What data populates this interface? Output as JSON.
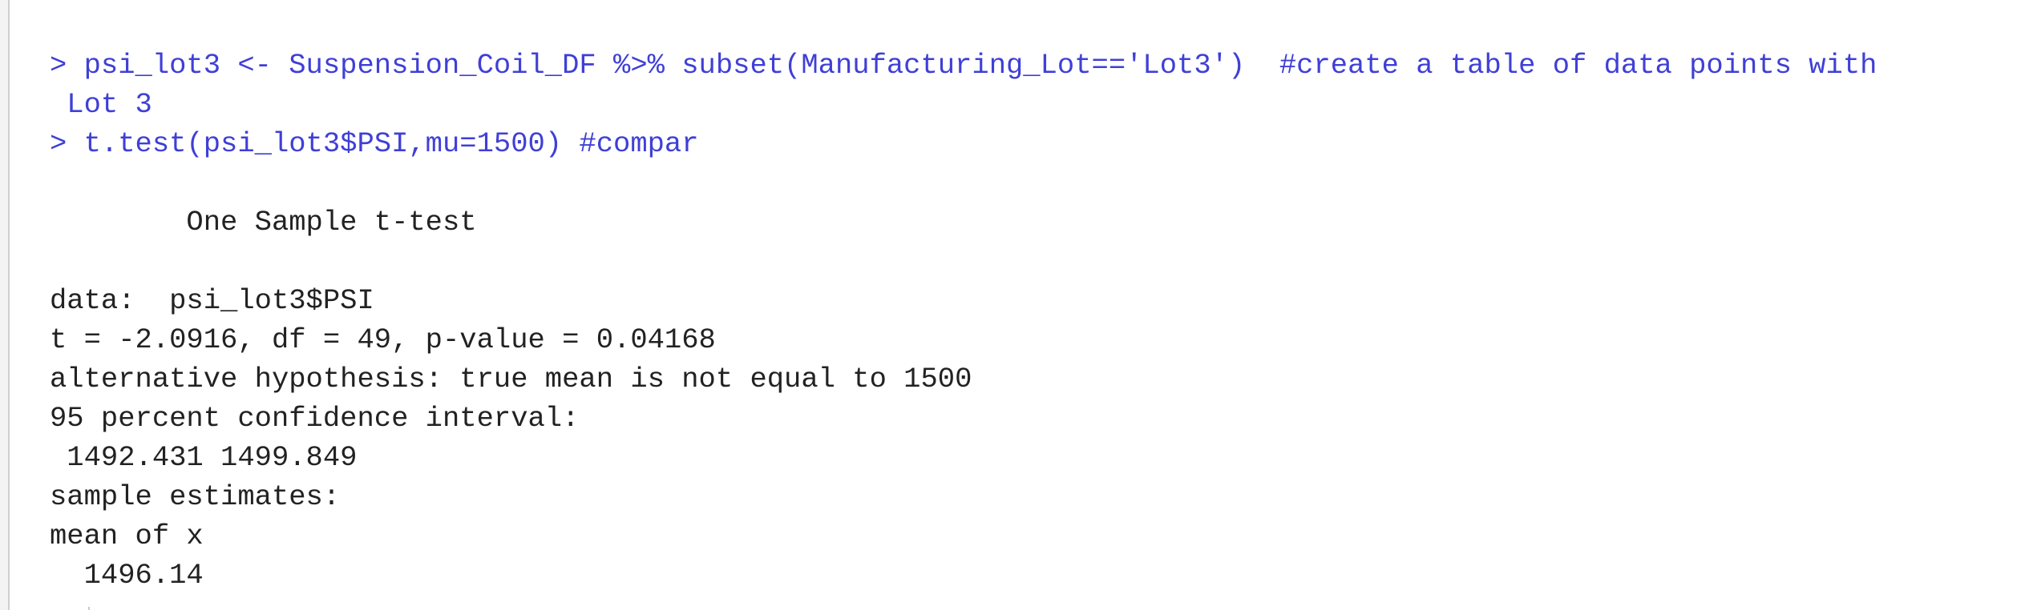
{
  "console": {
    "lines": [
      {
        "kind": "cmd",
        "text": "> psi_lot3 <- Suspension_Coil_DF %>% subset(Manufacturing_Lot=='Lot3')  #create a table of data points with"
      },
      {
        "kind": "cmd",
        "text": " Lot 3"
      },
      {
        "kind": "cmd",
        "text": "> t.test(psi_lot3$PSI,mu=1500) #compar"
      },
      {
        "kind": "out",
        "text": ""
      },
      {
        "kind": "out",
        "text": "        One Sample t-test"
      },
      {
        "kind": "out",
        "text": ""
      },
      {
        "kind": "out",
        "text": "data:  psi_lot3$PSI"
      },
      {
        "kind": "out",
        "text": "t = -2.0916, df = 49, p-value = 0.04168"
      },
      {
        "kind": "out",
        "text": "alternative hypothesis: true mean is not equal to 1500"
      },
      {
        "kind": "out",
        "text": "95 percent confidence interval:"
      },
      {
        "kind": "out",
        "text": " 1492.431 1499.849"
      },
      {
        "kind": "out",
        "text": "sample estimates:"
      },
      {
        "kind": "out",
        "text": "mean of x"
      },
      {
        "kind": "out",
        "text": "  1496.14"
      }
    ]
  }
}
